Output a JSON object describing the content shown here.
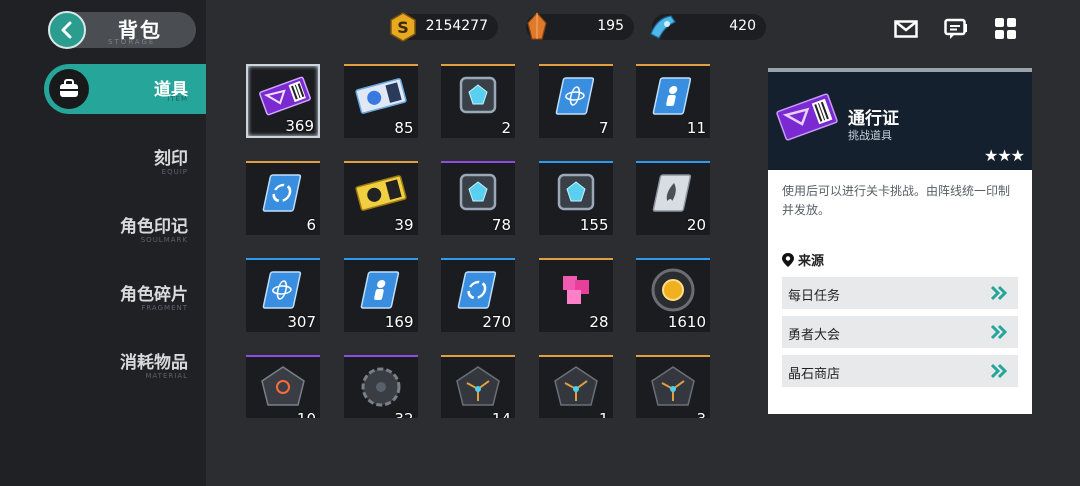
{
  "header": {
    "title": "背包",
    "subtitle": "STORAGE"
  },
  "currencies": [
    {
      "icon": "gold-coin-icon",
      "value": "2154277"
    },
    {
      "icon": "orange-crystal-icon",
      "value": "195"
    },
    {
      "icon": "blue-crystal-icon",
      "value": "420"
    }
  ],
  "sidebar": {
    "items": [
      {
        "label": "道具",
        "sub": "ITEM",
        "active": true
      },
      {
        "label": "刻印",
        "sub": "EQUIP"
      },
      {
        "label": "角色印记",
        "sub": "SOULMARK"
      },
      {
        "label": "角色碎片",
        "sub": "FRAGMENT"
      },
      {
        "label": "消耗物品",
        "sub": "MATERIAL"
      }
    ]
  },
  "items": [
    {
      "count": "369",
      "rarity": "selected",
      "icon": "purple-ticket-icon"
    },
    {
      "count": "85",
      "rarity": "gold",
      "icon": "blue-ticket-icon"
    },
    {
      "count": "2",
      "rarity": "gold",
      "icon": "crystal-cube-icon"
    },
    {
      "count": "7",
      "rarity": "gold",
      "icon": "atom-book-icon"
    },
    {
      "count": "11",
      "rarity": "gold",
      "icon": "figure-book-icon"
    },
    {
      "count": "6",
      "rarity": "gold",
      "icon": "swirl-book-icon"
    },
    {
      "count": "39",
      "rarity": "gold",
      "icon": "gold-ticket-icon"
    },
    {
      "count": "78",
      "rarity": "purple",
      "icon": "crystal-cube-icon"
    },
    {
      "count": "155",
      "rarity": "blue",
      "icon": "crystal-cube-icon"
    },
    {
      "count": "20",
      "rarity": "blue",
      "icon": "flame-book-icon"
    },
    {
      "count": "307",
      "rarity": "blue",
      "icon": "atom-book-icon"
    },
    {
      "count": "169",
      "rarity": "blue",
      "icon": "figure-book-icon"
    },
    {
      "count": "270",
      "rarity": "blue",
      "icon": "swirl-book-icon"
    },
    {
      "count": "28",
      "rarity": "gold",
      "icon": "pink-block-icon"
    },
    {
      "count": "1610",
      "rarity": "blue",
      "icon": "gold-orb-icon"
    },
    {
      "count": "10",
      "rarity": "purple",
      "icon": "chip-icon"
    },
    {
      "count": "32",
      "rarity": "purple",
      "icon": "gear-chip-icon"
    },
    {
      "count": "14",
      "rarity": "gold",
      "icon": "circuit-chip-icon"
    },
    {
      "count": "1",
      "rarity": "gold",
      "icon": "circuit-chip-icon"
    },
    {
      "count": "3",
      "rarity": "gold",
      "icon": "circuit-chip-icon"
    }
  ],
  "detail": {
    "name": "通行证",
    "type": "挑战道具",
    "stars": "★★★",
    "description": "使用后可以进行关卡挑战。由阵线统一印制并发放。",
    "source_title": "来源",
    "sources": [
      "每日任务",
      "勇者大会",
      "晶石商店"
    ]
  },
  "colors": {
    "accent": "#26a69a",
    "gold": "#e0a040",
    "blue": "#2c9cf0",
    "purple": "#8e4de0"
  }
}
